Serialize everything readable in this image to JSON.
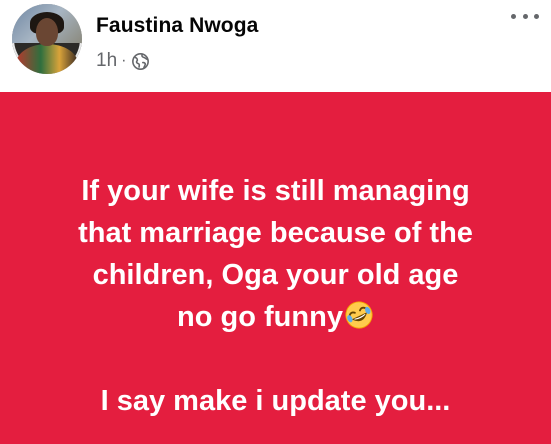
{
  "post": {
    "author": {
      "name": "Faustina Nwoga"
    },
    "meta": {
      "time": "1h",
      "separator": "·",
      "audience_icon": "globe-icon"
    },
    "more_icon": "more-options-icon",
    "background_color": "#e41e3f",
    "text_lines": [
      "If your wife is still managing",
      "that marriage because of the",
      "children, Oga your old age",
      "no go funny",
      "I say make i update you..."
    ],
    "emoji": "rolling-on-the-floor-laughing-icon"
  }
}
